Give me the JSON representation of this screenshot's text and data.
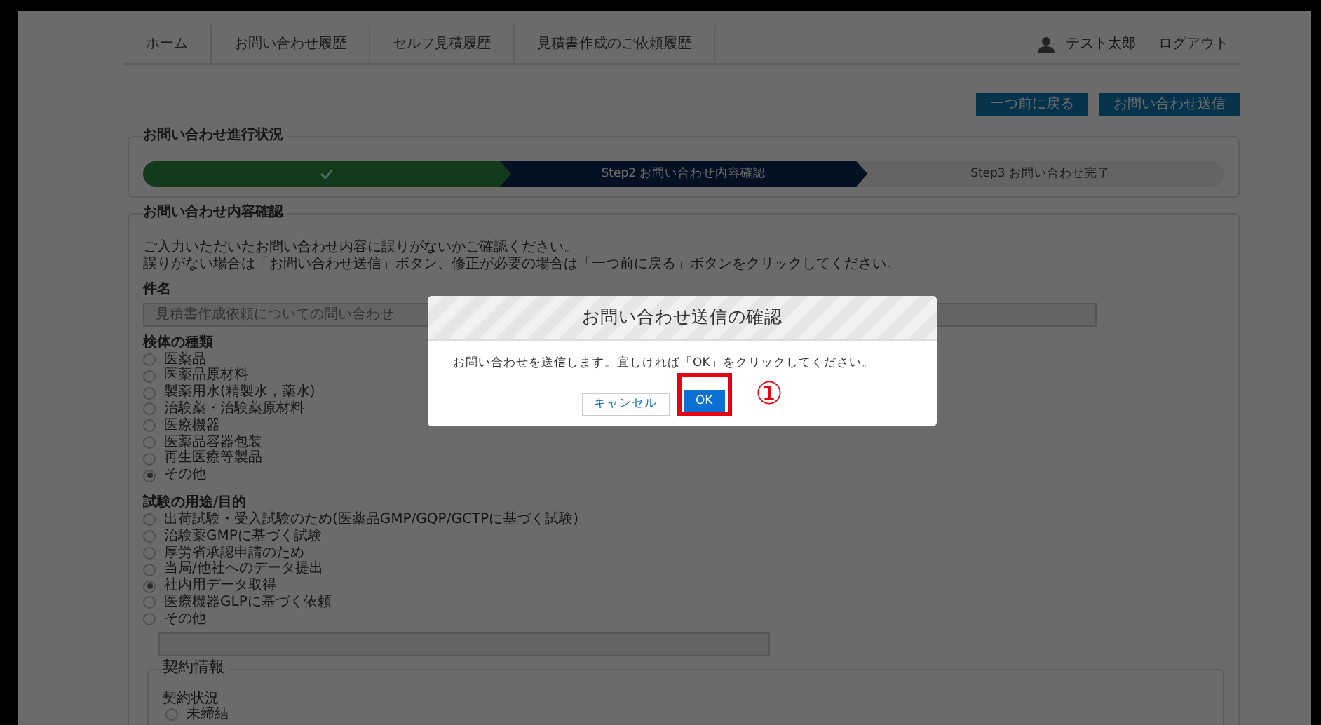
{
  "nav": {
    "items": [
      "ホーム",
      "お問い合わせ履歴",
      "セルフ見積履歴",
      "見積書作成のご依頼履歴"
    ],
    "user": "テスト太郎",
    "logout": "ログアウト"
  },
  "actions": [
    "一つ前に戻る",
    "お問い合わせ送信"
  ],
  "progress": {
    "title": "お問い合わせ進行状況",
    "steps": [
      {
        "kind": "done"
      },
      {
        "kind": "current",
        "label": "Step2 お問い合わせ内容確認"
      },
      {
        "kind": "todo",
        "label": "Step3 お問い合わせ完了"
      }
    ]
  },
  "content": {
    "title": "お問い合わせ内容確認",
    "intro": [
      "ご入力いただいたお問い合わせ内容に誤りがないかご確認ください。",
      "誤りがない場合は「お問い合わせ送信」ボタン、修正が必要の場合は「一つ前に戻る」ボタンをクリックしてください。"
    ],
    "subject": {
      "label": "件名",
      "value": "見積書作成依頼についての問い合わせ"
    },
    "sample_types": {
      "label": "検体の種類",
      "options": [
        {
          "label": "医薬品",
          "selected": false
        },
        {
          "label": "医薬品原材料",
          "selected": false
        },
        {
          "label": "製薬用水(精製水，薬水)",
          "selected": false
        },
        {
          "label": "治験薬・治験薬原材料",
          "selected": false
        },
        {
          "label": "医療機器",
          "selected": false
        },
        {
          "label": "医薬品容器包装",
          "selected": false
        },
        {
          "label": "再生医療等製品",
          "selected": false
        },
        {
          "label": "その他",
          "selected": true
        }
      ]
    },
    "purposes": {
      "label": "試験の用途/目的",
      "options": [
        {
          "label": "出荷試験・受入試験のため(医薬品GMP/GQP/GCTPに基づく試験)",
          "selected": false
        },
        {
          "label": "治験薬GMPに基づく試験",
          "selected": false
        },
        {
          "label": "厚労省承認申請のため",
          "selected": false
        },
        {
          "label": "当局/他社へのデータ提出",
          "selected": false
        },
        {
          "label": "社内用データ取得",
          "selected": true
        },
        {
          "label": "医療機器GLPに基づく依頼",
          "selected": false
        },
        {
          "label": "その他",
          "selected": false
        }
      ]
    },
    "contract": {
      "legend": "契約情報",
      "label": "契約状況",
      "options": [
        {
          "label": "未締結",
          "selected": false
        }
      ]
    }
  },
  "modal": {
    "title": "お問い合わせ送信の確認",
    "message": "お問い合わせを送信します。宜しければ「OK」をクリックしてください。",
    "cancel": "キャンセル",
    "ok": "OK",
    "annotation": "①"
  }
}
